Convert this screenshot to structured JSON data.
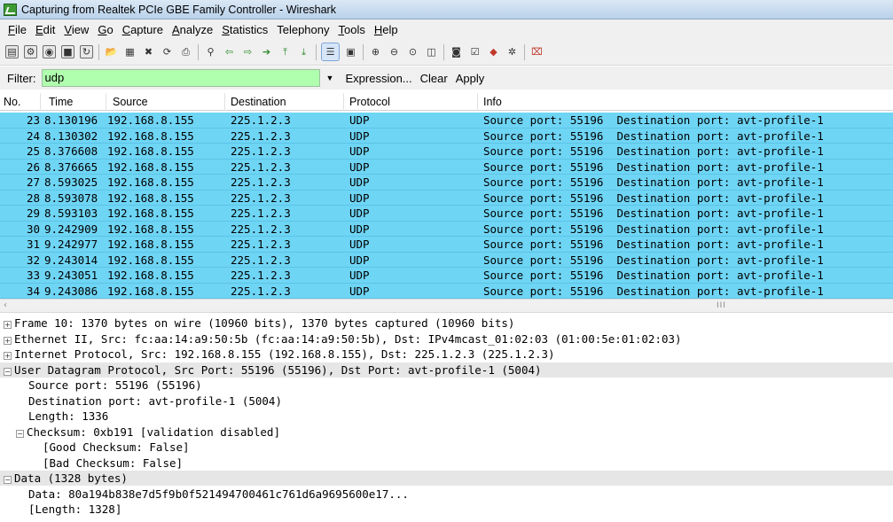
{
  "window": {
    "title": "Capturing from Realtek PCIe GBE Family Controller - Wireshark"
  },
  "menu": [
    {
      "acc": "F",
      "rest": "ile"
    },
    {
      "acc": "E",
      "rest": "dit"
    },
    {
      "acc": "V",
      "rest": "iew"
    },
    {
      "acc": "G",
      "rest": "o"
    },
    {
      "acc": "C",
      "rest": "apture"
    },
    {
      "acc": "A",
      "rest": "nalyze"
    },
    {
      "acc": "S",
      "rest": "tatistics"
    },
    {
      "acc": "",
      "rest": "Telephony"
    },
    {
      "acc": "T",
      "rest": "ools"
    },
    {
      "acc": "H",
      "rest": "elp"
    }
  ],
  "filter": {
    "label": "Filter:",
    "value": "udp",
    "dropdown_glyph": "▼",
    "expression_label": "Expression...",
    "clear_label": "Clear",
    "apply_label": "Apply"
  },
  "packet_list": {
    "columns": [
      "No.",
      "Time",
      "Source",
      "Destination",
      "Protocol",
      "Info"
    ],
    "rows": [
      {
        "no": "23",
        "time": "8.130196",
        "src": "192.168.8.155",
        "dst": "225.1.2.3",
        "proto": "UDP",
        "info": "Source port: 55196  Destination port: avt-profile-1"
      },
      {
        "no": "24",
        "time": "8.130302",
        "src": "192.168.8.155",
        "dst": "225.1.2.3",
        "proto": "UDP",
        "info": "Source port: 55196  Destination port: avt-profile-1"
      },
      {
        "no": "25",
        "time": "8.376608",
        "src": "192.168.8.155",
        "dst": "225.1.2.3",
        "proto": "UDP",
        "info": "Source port: 55196  Destination port: avt-profile-1"
      },
      {
        "no": "26",
        "time": "8.376665",
        "src": "192.168.8.155",
        "dst": "225.1.2.3",
        "proto": "UDP",
        "info": "Source port: 55196  Destination port: avt-profile-1"
      },
      {
        "no": "27",
        "time": "8.593025",
        "src": "192.168.8.155",
        "dst": "225.1.2.3",
        "proto": "UDP",
        "info": "Source port: 55196  Destination port: avt-profile-1"
      },
      {
        "no": "28",
        "time": "8.593078",
        "src": "192.168.8.155",
        "dst": "225.1.2.3",
        "proto": "UDP",
        "info": "Source port: 55196  Destination port: avt-profile-1"
      },
      {
        "no": "29",
        "time": "8.593103",
        "src": "192.168.8.155",
        "dst": "225.1.2.3",
        "proto": "UDP",
        "info": "Source port: 55196  Destination port: avt-profile-1"
      },
      {
        "no": "30",
        "time": "9.242909",
        "src": "192.168.8.155",
        "dst": "225.1.2.3",
        "proto": "UDP",
        "info": "Source port: 55196  Destination port: avt-profile-1"
      },
      {
        "no": "31",
        "time": "9.242977",
        "src": "192.168.8.155",
        "dst": "225.1.2.3",
        "proto": "UDP",
        "info": "Source port: 55196  Destination port: avt-profile-1"
      },
      {
        "no": "32",
        "time": "9.243014",
        "src": "192.168.8.155",
        "dst": "225.1.2.3",
        "proto": "UDP",
        "info": "Source port: 55196  Destination port: avt-profile-1"
      },
      {
        "no": "33",
        "time": "9.243051",
        "src": "192.168.8.155",
        "dst": "225.1.2.3",
        "proto": "UDP",
        "info": "Source port: 55196  Destination port: avt-profile-1"
      },
      {
        "no": "34",
        "time": "9.243086",
        "src": "192.168.8.155",
        "dst": "225.1.2.3",
        "proto": "UDP",
        "info": "Source port: 55196  Destination port: avt-profile-1"
      }
    ]
  },
  "scrollbar": {
    "left_arrow": "‹",
    "grip": "III"
  },
  "details": [
    {
      "indent": 0,
      "exp": "+",
      "text": "Frame 10: 1370 bytes on wire (10960 bits), 1370 bytes captured (10960 bits)",
      "sel": false
    },
    {
      "indent": 0,
      "exp": "+",
      "text": "Ethernet II, Src: fc:aa:14:a9:50:5b (fc:aa:14:a9:50:5b), Dst: IPv4mcast_01:02:03 (01:00:5e:01:02:03)",
      "sel": false
    },
    {
      "indent": 0,
      "exp": "+",
      "text": "Internet Protocol, Src: 192.168.8.155 (192.168.8.155), Dst: 225.1.2.3 (225.1.2.3)",
      "sel": false
    },
    {
      "indent": 0,
      "exp": "−",
      "text": "User Datagram Protocol, Src Port: 55196 (55196), Dst Port: avt-profile-1 (5004)",
      "sel": true
    },
    {
      "indent": 1,
      "exp": "",
      "text": "Source port: 55196 (55196)",
      "sel": false
    },
    {
      "indent": 1,
      "exp": "",
      "text": "Destination port: avt-profile-1 (5004)",
      "sel": false
    },
    {
      "indent": 1,
      "exp": "",
      "text": "Length: 1336",
      "sel": false
    },
    {
      "indent": 1,
      "exp": "−",
      "text": "Checksum: 0xb191 [validation disabled]",
      "sel": false
    },
    {
      "indent": 2,
      "exp": "",
      "text": "[Good Checksum: False]",
      "sel": false
    },
    {
      "indent": 2,
      "exp": "",
      "text": "[Bad Checksum: False]",
      "sel": false
    },
    {
      "indent": 0,
      "exp": "−",
      "text": "Data (1328 bytes)",
      "sel": true
    },
    {
      "indent": 1,
      "exp": "",
      "text": "Data: 80a194b838e7d5f9b0f521494700461c761d6a9695600e17...",
      "sel": false
    },
    {
      "indent": 1,
      "exp": "",
      "text": "[Length: 1328]",
      "sel": false
    }
  ]
}
